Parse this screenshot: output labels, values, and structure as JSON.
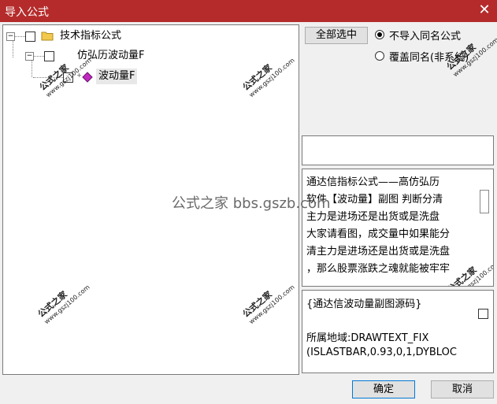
{
  "window": {
    "title": "导入公式",
    "close_glyph": "✕"
  },
  "tree": {
    "root": {
      "label": "技术指标公式",
      "expander": "−"
    },
    "child": {
      "label": "仿弘历波动量F",
      "expander": "−"
    },
    "leaf": {
      "label": "波动量F",
      "expander": "+"
    }
  },
  "options": {
    "select_all_label": "全部选中",
    "radio_skip_label": "不导入同名公式",
    "radio_overwrite_label": "覆盖同名(非系统)",
    "selected": "skip"
  },
  "description": {
    "lines": [
      "通达信指标公式——高仿弘历",
      "软件【波动量】副图 判断分清",
      "主力是进场还是出货或是洗盘",
      "大家请看图，成交量中如果能分",
      "清主力是进场还是出货或是洗盘",
      "，那么股票涨跌之魂就能被牢牢"
    ]
  },
  "source": {
    "lines": [
      "{通达信波动量副图源码}",
      "",
      "所属地域:DRAWTEXT_FIX",
      "(ISLASTBAR,0.93,0,1,DYBLOC"
    ]
  },
  "footer": {
    "ok_label": "确定",
    "cancel_label": "取消"
  },
  "watermark": {
    "brand": "公式之家",
    "url": "www.gszj100.com",
    "center_text": "公式之家 bbs.gszb.com"
  },
  "colors": {
    "titlebar": "#b52b2b",
    "accent": "#0078d7"
  }
}
